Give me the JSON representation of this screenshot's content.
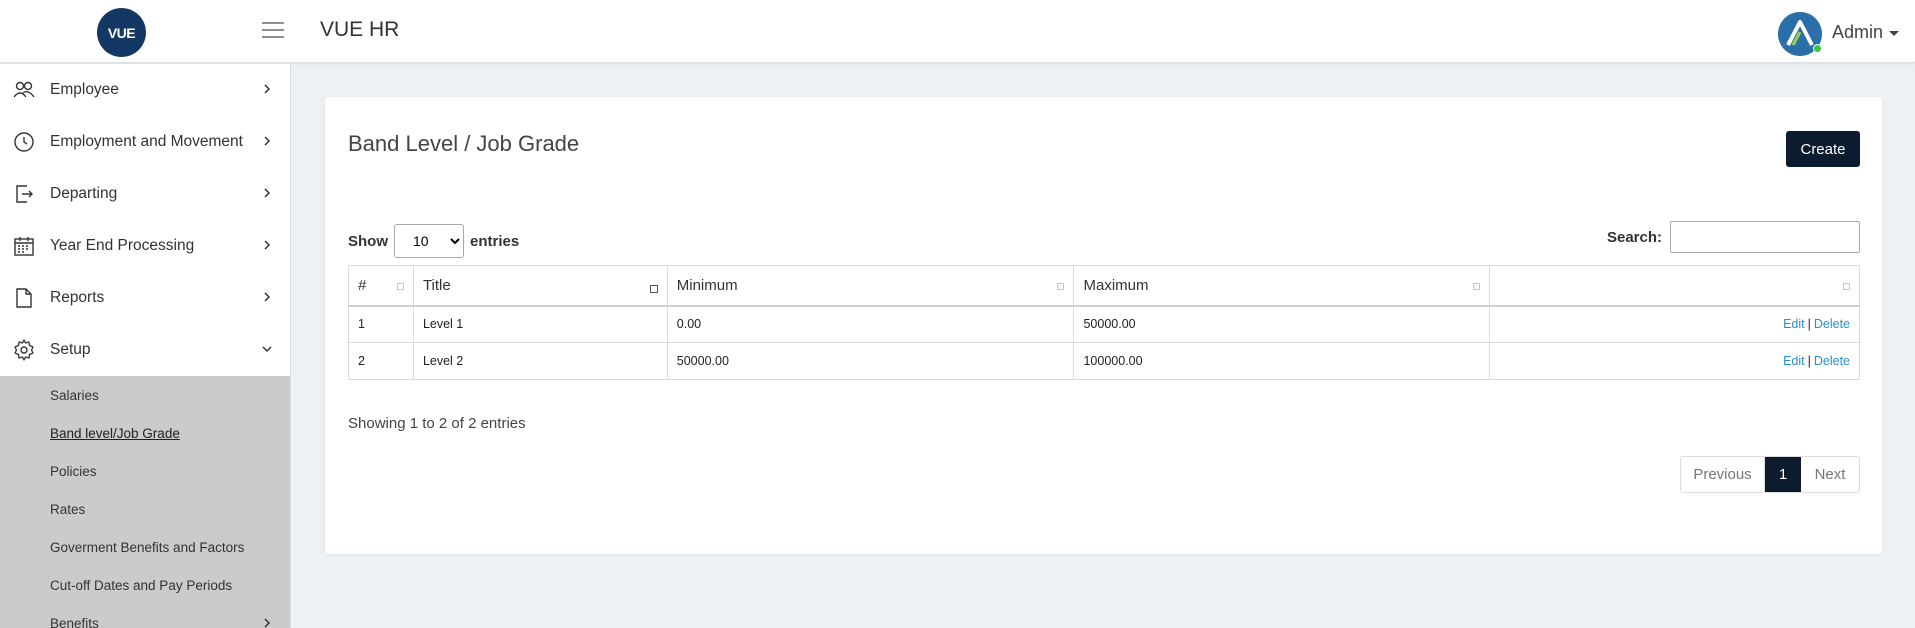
{
  "header": {
    "logo_text": "VUE",
    "app_title": "VUE HR",
    "user_name": "Admin"
  },
  "sidebar": {
    "items": [
      {
        "label": "Employee",
        "icon": "users-icon"
      },
      {
        "label": "Employment and Movement",
        "icon": "clock-icon"
      },
      {
        "label": "Departing",
        "icon": "exit-icon"
      },
      {
        "label": "Year End Processing",
        "icon": "calendar-icon"
      },
      {
        "label": "Reports",
        "icon": "document-icon"
      },
      {
        "label": "Setup",
        "icon": "gear-icon"
      }
    ],
    "setup_subitems": [
      {
        "label": "Salaries"
      },
      {
        "label": "Band level/Job Grade"
      },
      {
        "label": "Policies"
      },
      {
        "label": "Rates"
      },
      {
        "label": "Goverment Benefits and Factors"
      },
      {
        "label": "Cut-off Dates and Pay Periods"
      },
      {
        "label": "Benefits"
      }
    ]
  },
  "page": {
    "title": "Band Level / Job Grade",
    "create_label": "Create",
    "show_label": "Show",
    "entries_label": "entries",
    "page_size": "10",
    "search_label": "Search:",
    "info": "Showing 1 to 2 of 2 entries"
  },
  "table": {
    "columns": [
      "#",
      "Title",
      "Minimum",
      "Maximum",
      ""
    ],
    "rows": [
      {
        "num": "1",
        "title": "Level 1",
        "minimum": "0.00",
        "maximum": "50000.00"
      },
      {
        "num": "2",
        "title": "Level 2",
        "minimum": "50000.00",
        "maximum": "100000.00"
      }
    ],
    "edit_label": "Edit",
    "delete_label": "Delete",
    "separator": "|"
  },
  "pagination": {
    "previous": "Previous",
    "current": "1",
    "next": "Next"
  },
  "colors": {
    "brand_navy": "#143864",
    "button_dark": "#0d1b2e",
    "link_blue": "#2b8fcf",
    "status_online": "#2ecc40"
  }
}
